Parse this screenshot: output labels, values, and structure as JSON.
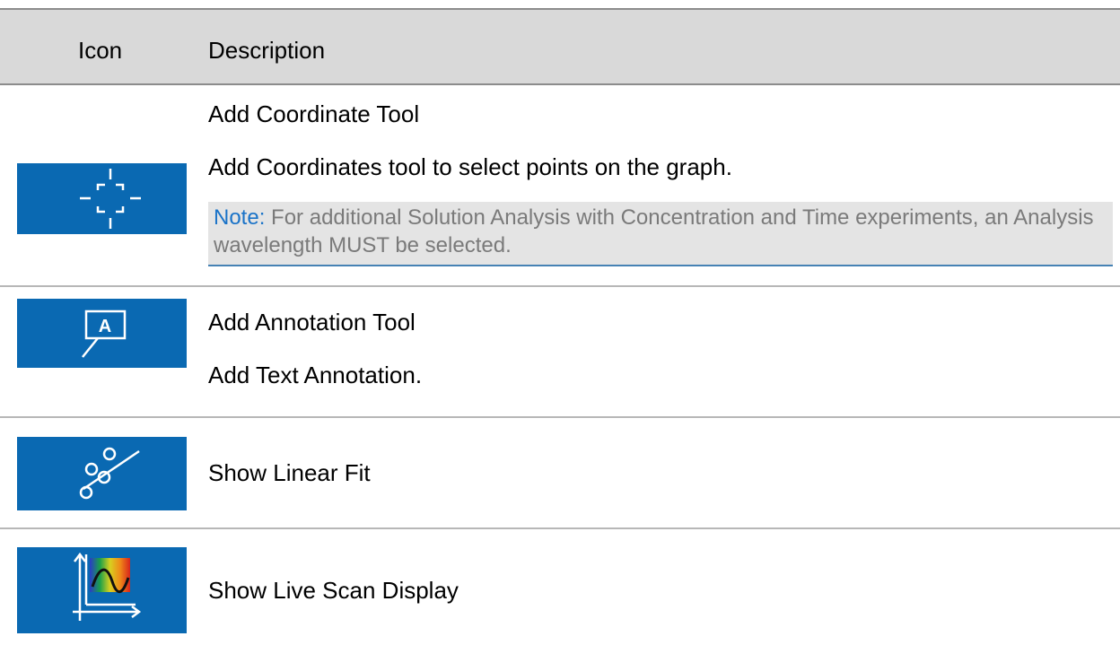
{
  "table": {
    "headers": {
      "icon": "Icon",
      "description": "Description"
    },
    "rows": [
      {
        "icon": "coordinate-crosshair-icon",
        "title": "Add Coordinate Tool",
        "body": "Add Coordinates tool to select points on the graph.",
        "note": {
          "label": "Note:",
          "text": "For additional Solution Analysis with Concentration and Time experiments, an Analysis wavelength MUST be selected."
        }
      },
      {
        "icon": "annotation-icon",
        "icon_letter": "A",
        "title": "Add Annotation Tool",
        "body": "Add Text Annotation."
      },
      {
        "icon": "percent-linear-fit-icon",
        "title": "Show Linear Fit"
      },
      {
        "icon": "live-scan-spectrum-icon",
        "title": "Show Live Scan Display"
      }
    ]
  },
  "colors": {
    "icon_background": "#0a69b2",
    "header_background": "#d9d9d9",
    "note_background": "#e4e4e4",
    "note_label": "#1a73c8",
    "note_text": "#7a7a7a"
  }
}
